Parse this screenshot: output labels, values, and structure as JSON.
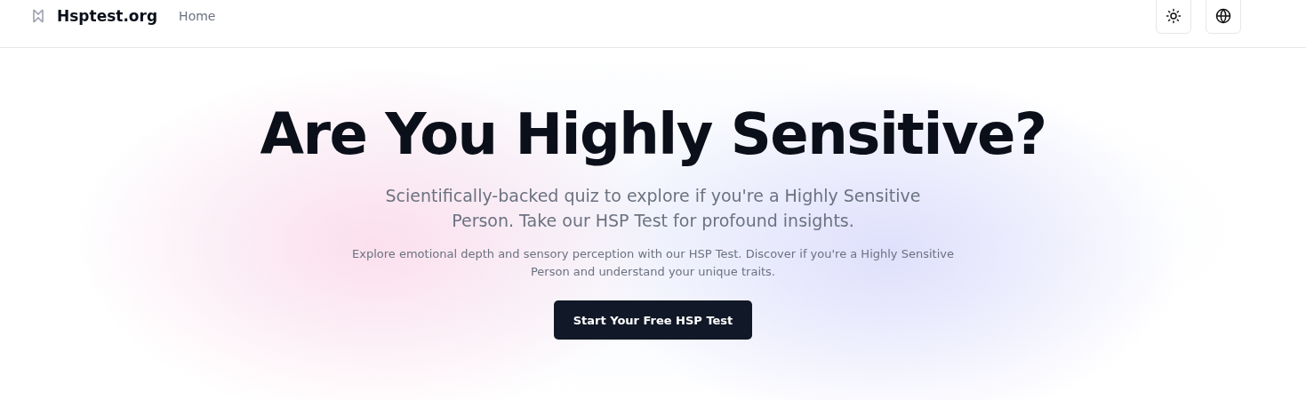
{
  "header": {
    "logo": "Hsptest.org",
    "nav": [
      {
        "label": "Home"
      }
    ]
  },
  "hero": {
    "title": "Are You Highly Sensitive?",
    "subtitle": "Scientifically-backed quiz to explore if you're a Highly Sensitive Person. Take our HSP Test for profound insights.",
    "description": "Explore emotional depth and sensory perception with our HSP Test. Discover if you're a Highly Sensitive Person and understand your unique traits.",
    "button": "Start Your Free HSP Test"
  }
}
